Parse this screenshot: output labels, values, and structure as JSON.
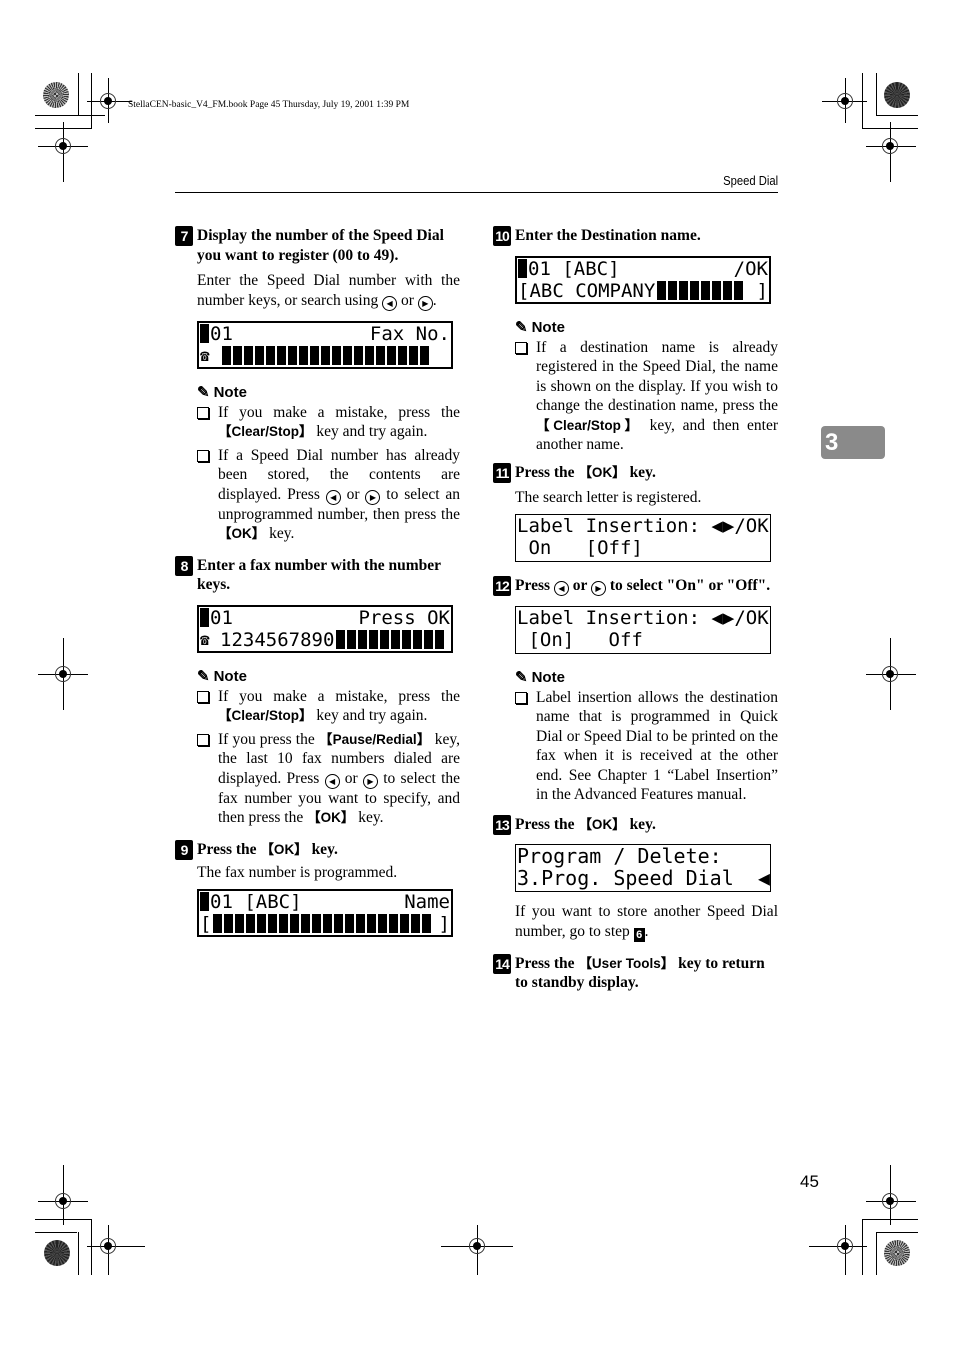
{
  "book_info": "StellaCEN-basic_V4_FM.book  Page 45  Thursday, July 19, 2001  1:39 PM",
  "header": {
    "section_title": "Speed Dial"
  },
  "chapter_tab": "3",
  "page_number": "45",
  "icons": {
    "note": "pencil-icon",
    "left_arrow": "left-arrow-key-icon",
    "right_arrow": "right-arrow-key-icon",
    "checkbox": "checkbox-bullet-icon",
    "phone": "phone-icon"
  },
  "left_column": {
    "step7": {
      "num": "7",
      "title": "Display the number of the Speed Dial you want to register (00 to 49).",
      "body_a": "Enter the Speed Dial number with the number keys, or search using",
      "body_or": "or",
      "lcd": {
        "line1_left": "01",
        "line1_right": "Fax No."
      },
      "note_label": "Note",
      "notes": [
        {
          "a": "If you make a mistake, press the",
          "key": "【Clear/Stop】",
          "b": "key and try again."
        },
        {
          "a": "If a Speed Dial number has already been stored, the contents are displayed. Press",
          "or": "or",
          "b": "to select an unprogrammed number, then press the",
          "key": "【OK】",
          "c": "key."
        }
      ]
    },
    "step8": {
      "num": "8",
      "title": "Enter a fax number with the number keys.",
      "lcd": {
        "line1_left": "01",
        "line1_right": "Press OK",
        "line2_number": "1234567890"
      },
      "note_label": "Note",
      "notes": [
        {
          "a": "If you make a mistake, press the",
          "key": "【Clear/Stop】",
          "b": "key and try again."
        },
        {
          "a": "If you press the",
          "key": "【Pause/Redial】",
          "b": "key, the last 10 fax numbers dialed are displayed. Press",
          "or": "or",
          "c": "to select the fax number you want to specify, and then press the",
          "key2": "【OK】",
          "d": "key."
        }
      ]
    },
    "step9": {
      "num": "9",
      "title_a": "Press the",
      "title_key": "【OK】",
      "title_b": "key.",
      "body": "The fax number is programmed.",
      "lcd": {
        "line1_left": "01 [ABC]",
        "line1_right": "Name",
        "line2_open": "[",
        "line2_close": "]"
      }
    }
  },
  "right_column": {
    "step10": {
      "num": "10",
      "title": "Enter the Destination name.",
      "lcd": {
        "line1_left": "01 [ABC]",
        "line1_right": "/OK",
        "line2_text": "[ABC COMPANY",
        "line2_close": "]"
      },
      "note_label": "Note",
      "notes": [
        {
          "a": "If a destination name is already registered in the Speed Dial, the name is shown on the display. If you wish to change the destination name, press the",
          "key": "【Clear/Stop】",
          "b": "key, and then enter another name."
        }
      ]
    },
    "step11": {
      "num": "11",
      "title_a": "Press the",
      "title_key": "【OK】",
      "title_b": "key.",
      "body": "The search letter is registered.",
      "lcd": {
        "line1": "Label Insertion: ◀▶/OK",
        "line2": " On   [Off]"
      }
    },
    "step12": {
      "num": "12",
      "title_a": "Press",
      "title_or": "or",
      "title_b": "to select \"On\" or \"Off\".",
      "lcd": {
        "line1": "Label Insertion: ◀▶/OK",
        "line2": " [On]   Off"
      },
      "note_label": "Note",
      "notes": [
        {
          "a": "Label insertion allows the destination name that is programmed in Quick Dial or Speed Dial to be printed on the fax when it is received at the other end. See Chapter 1 “Label Insertion” in the Advanced Features manual."
        }
      ]
    },
    "step13": {
      "num": "13",
      "title_a": "Press the",
      "title_key": "【OK】",
      "title_b": "key.",
      "lcd": {
        "line1": "Program / Delete:",
        "line2": "3.Prog. Speed Dial  ◀▶"
      },
      "body_a": "If you want to store another Speed Dial number, go to step",
      "body_step": "6",
      "body_b": "."
    },
    "step14": {
      "num": "14",
      "title_a": "Press the",
      "title_key": "【User Tools】",
      "title_b": "key to return to standby display."
    }
  }
}
